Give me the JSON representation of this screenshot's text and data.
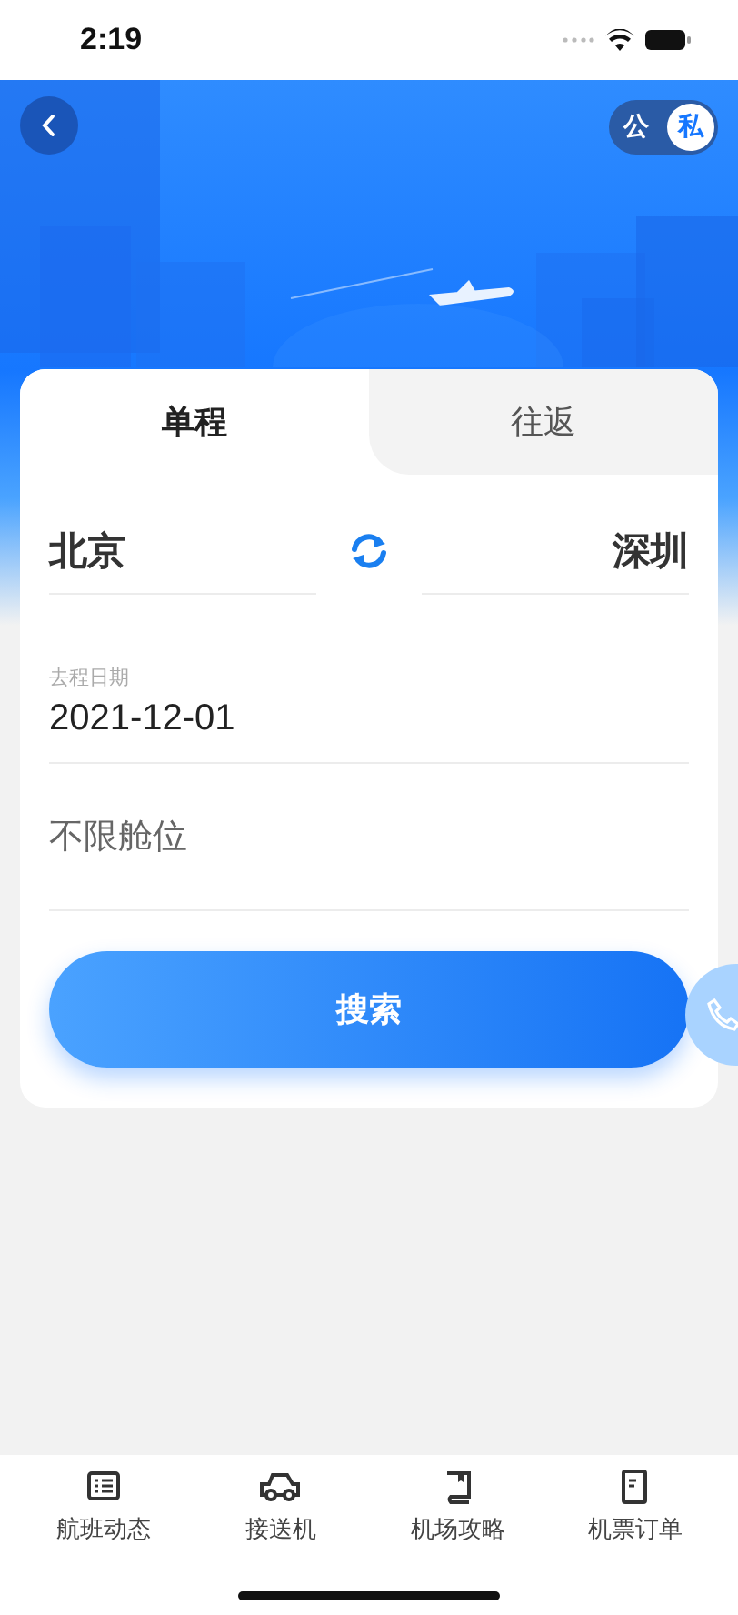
{
  "status_bar": {
    "time": "2:19"
  },
  "header": {
    "account_toggle": [
      {
        "label": "公",
        "selected": false
      },
      {
        "label": "私",
        "selected": true
      }
    ]
  },
  "trip_tabs": [
    {
      "label": "单程",
      "selected": true
    },
    {
      "label": "往返",
      "selected": false
    }
  ],
  "route": {
    "from": "北京",
    "to": "深圳"
  },
  "date_field": {
    "label": "去程日期",
    "value": "2021-12-01"
  },
  "cabin_field": {
    "placeholder": "不限舱位"
  },
  "search_button": "搜索",
  "bottom_nav": [
    {
      "label": "航班动态",
      "kind": "list"
    },
    {
      "label": "接送机",
      "kind": "car"
    },
    {
      "label": "机场攻略",
      "kind": "book"
    },
    {
      "label": "机票订单",
      "kind": "document"
    }
  ]
}
